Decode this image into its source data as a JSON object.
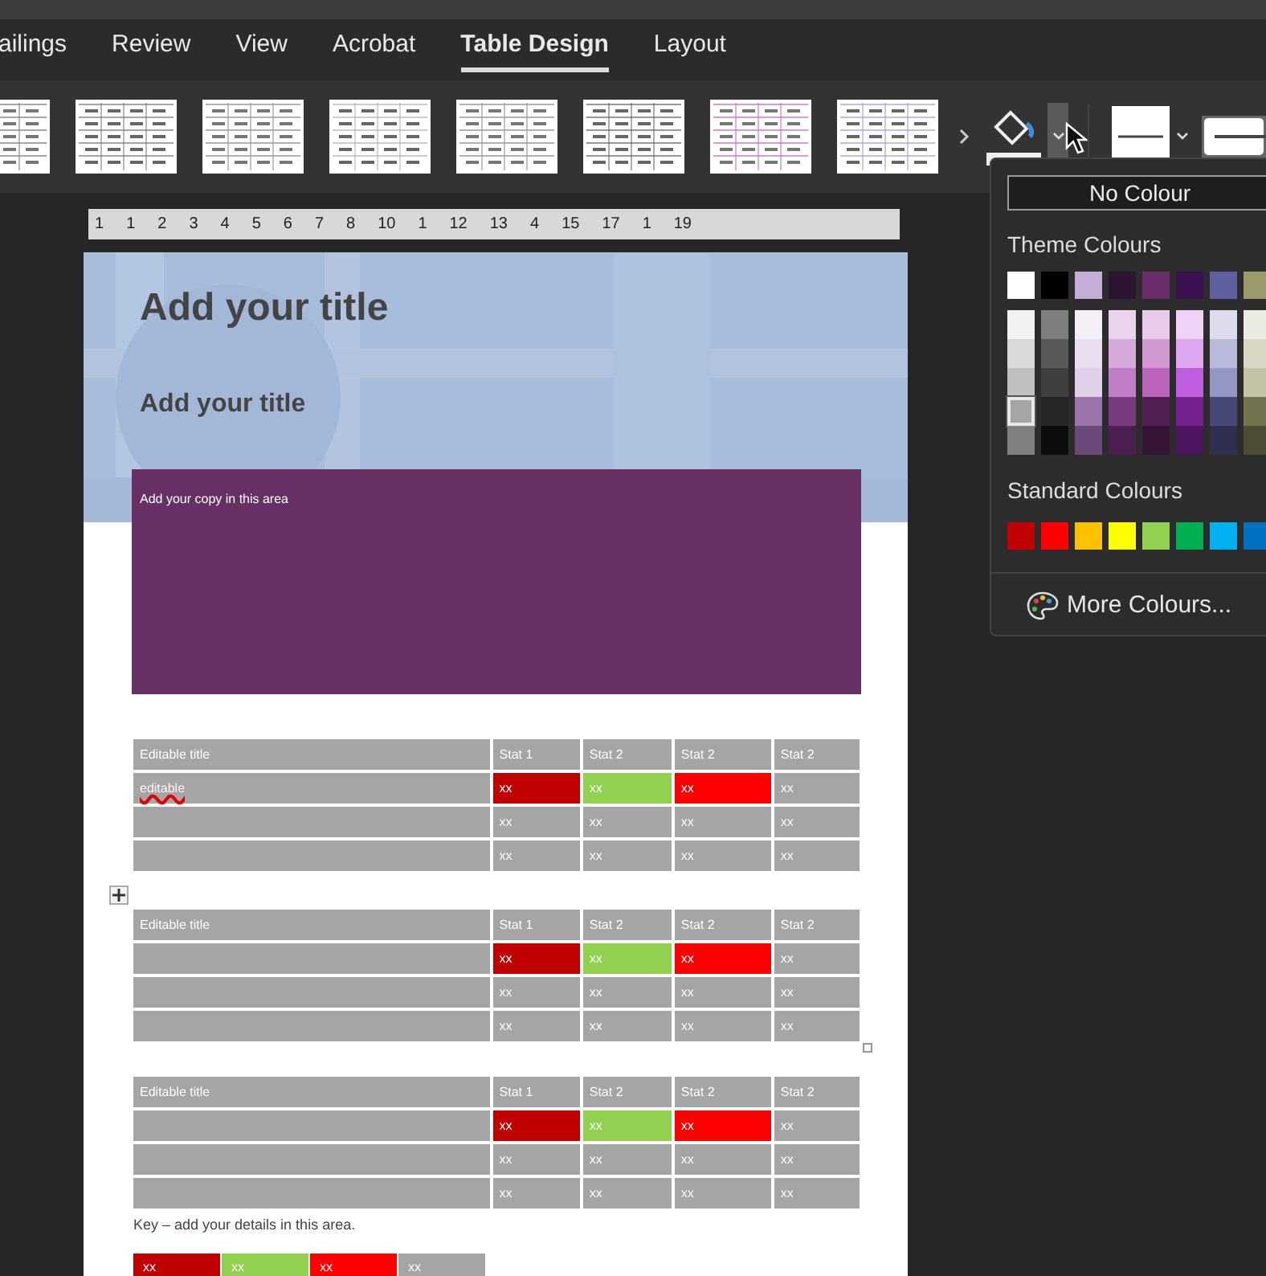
{
  "tabs": [
    {
      "label": "ailings",
      "selected": false
    },
    {
      "label": "Review",
      "selected": false
    },
    {
      "label": "View",
      "selected": false
    },
    {
      "label": "Acrobat",
      "selected": false
    },
    {
      "label": "Table Design",
      "selected": true
    },
    {
      "label": "Layout",
      "selected": false
    }
  ],
  "ruler": [
    "1",
    "1",
    "2",
    "3",
    "4",
    "5",
    "6",
    "7",
    "8",
    "10",
    "1",
    "12",
    "13",
    "4",
    "15",
    "17",
    "1",
    "19"
  ],
  "document": {
    "title": "Add your title",
    "subtitle": "Add your title",
    "copy": "Add your copy in this area",
    "tables": [
      {
        "header": [
          "Editable title",
          "Stat 1",
          "Stat 2",
          "Stat 2",
          "Stat 2"
        ],
        "rows": [
          {
            "label": "editable",
            "misspelled": true,
            "cells": [
              {
                "text": "xx",
                "color": "#c00000"
              },
              {
                "text": "xx",
                "color": "#92d050"
              },
              {
                "text": "xx",
                "color": "#ff0000"
              },
              {
                "text": "xx",
                "color": "#a5a5a5"
              }
            ]
          },
          {
            "cells": [
              {
                "text": "xx",
                "color": "#a5a5a5"
              },
              {
                "text": "xx",
                "color": "#a5a5a5"
              },
              {
                "text": "xx",
                "color": "#a5a5a5"
              },
              {
                "text": "xx",
                "color": "#a5a5a5"
              }
            ]
          },
          {
            "cells": [
              {
                "text": "xx",
                "color": "#a5a5a5"
              },
              {
                "text": "xx",
                "color": "#a5a5a5"
              },
              {
                "text": "xx",
                "color": "#a5a5a5"
              },
              {
                "text": "xx",
                "color": "#a5a5a5"
              }
            ]
          }
        ]
      },
      {
        "header": [
          "Editable title",
          "Stat 1",
          "Stat 2",
          "Stat 2",
          "Stat 2"
        ],
        "rows": [
          {
            "cells": [
              {
                "text": "xx",
                "color": "#c00000"
              },
              {
                "text": "xx",
                "color": "#92d050"
              },
              {
                "text": "xx",
                "color": "#ff0000"
              },
              {
                "text": "xx",
                "color": "#a5a5a5"
              }
            ]
          },
          {
            "cells": [
              {
                "text": "xx",
                "color": "#a5a5a5"
              },
              {
                "text": "xx",
                "color": "#a5a5a5"
              },
              {
                "text": "xx",
                "color": "#a5a5a5"
              },
              {
                "text": "xx",
                "color": "#a5a5a5"
              }
            ]
          },
          {
            "cells": [
              {
                "text": "xx",
                "color": "#a5a5a5"
              },
              {
                "text": "xx",
                "color": "#a5a5a5"
              },
              {
                "text": "xx",
                "color": "#a5a5a5"
              },
              {
                "text": "xx",
                "color": "#a5a5a5"
              }
            ]
          }
        ]
      },
      {
        "header": [
          "Editable title",
          "Stat 1",
          "Stat 2",
          "Stat 2",
          "Stat 2"
        ],
        "rows": [
          {
            "cells": [
              {
                "text": "xx",
                "color": "#c00000"
              },
              {
                "text": "xx",
                "color": "#92d050"
              },
              {
                "text": "xx",
                "color": "#ff0000"
              },
              {
                "text": "xx",
                "color": "#a5a5a5"
              }
            ]
          },
          {
            "cells": [
              {
                "text": "xx",
                "color": "#a5a5a5"
              },
              {
                "text": "xx",
                "color": "#a5a5a5"
              },
              {
                "text": "xx",
                "color": "#a5a5a5"
              },
              {
                "text": "xx",
                "color": "#a5a5a5"
              }
            ]
          },
          {
            "cells": [
              {
                "text": "xx",
                "color": "#a5a5a5"
              },
              {
                "text": "xx",
                "color": "#a5a5a5"
              },
              {
                "text": "xx",
                "color": "#a5a5a5"
              },
              {
                "text": "xx",
                "color": "#a5a5a5"
              }
            ]
          }
        ]
      }
    ],
    "key_text": "Key – add your details in this area.",
    "key": [
      {
        "text": "xx",
        "color": "#c00000"
      },
      {
        "text": "xx",
        "color": "#92d050"
      },
      {
        "text": "xx",
        "color": "#ff0000"
      },
      {
        "text": "xx",
        "color": "#a5a5a5"
      }
    ]
  },
  "colour_menu": {
    "no_colour": "No Colour",
    "theme_label": "Theme Colours",
    "theme": [
      {
        "color": "#ffffff",
        "selected": false
      },
      {
        "color": "#000000",
        "selected": false
      },
      {
        "color": "#c5aed6",
        "selected": false
      },
      {
        "color": "#2c1530",
        "selected": false
      },
      {
        "color": "#6b2c6b",
        "selected": false
      },
      {
        "color": "#3a1050",
        "selected": false
      },
      {
        "color": "#6060a0",
        "selected": false
      },
      {
        "color": "#9b9b6b",
        "selected": false
      }
    ],
    "tints": [
      [
        {
          "color": "#f2f2f2",
          "selected": false
        },
        {
          "color": "#d9d9d9",
          "selected": false
        },
        {
          "color": "#bfbfbf",
          "selected": false
        },
        {
          "color": "#a6a6a6",
          "selected": true
        },
        {
          "color": "#808080",
          "selected": false
        }
      ],
      [
        {
          "color": "#7f7f7f",
          "selected": false
        },
        {
          "color": "#595959",
          "selected": false
        },
        {
          "color": "#3f3f3f",
          "selected": false
        },
        {
          "color": "#262626",
          "selected": false
        },
        {
          "color": "#0d0d0d",
          "selected": false
        }
      ],
      [
        {
          "color": "#f4eff7",
          "selected": false
        },
        {
          "color": "#eadff0",
          "selected": false
        },
        {
          "color": "#dfcfe8",
          "selected": false
        },
        {
          "color": "#9c74ac",
          "selected": false
        },
        {
          "color": "#6a4a78",
          "selected": false
        }
      ],
      [
        {
          "color": "#ead4ec",
          "selected": false
        },
        {
          "color": "#d5a9da",
          "selected": false
        },
        {
          "color": "#c07ec7",
          "selected": false
        },
        {
          "color": "#7a3a80",
          "selected": false
        },
        {
          "color": "#4b1f50",
          "selected": false
        }
      ],
      [
        {
          "color": "#e8cbe8",
          "selected": false
        },
        {
          "color": "#d197d1",
          "selected": false
        },
        {
          "color": "#ba63ba",
          "selected": false
        },
        {
          "color": "#521f52",
          "selected": false
        },
        {
          "color": "#361436",
          "selected": false
        }
      ],
      [
        {
          "color": "#efd3f7",
          "selected": false
        },
        {
          "color": "#dea6ef",
          "selected": false
        },
        {
          "color": "#c05ee0",
          "selected": false
        },
        {
          "color": "#75208f",
          "selected": false
        },
        {
          "color": "#4c155d",
          "selected": false
        }
      ],
      [
        {
          "color": "#dcdcec",
          "selected": false
        },
        {
          "color": "#b9b9d9",
          "selected": false
        },
        {
          "color": "#9696c5",
          "selected": false
        },
        {
          "color": "#474778",
          "selected": false
        },
        {
          "color": "#2f2f4f",
          "selected": false
        }
      ],
      [
        {
          "color": "#ebebe1",
          "selected": false
        },
        {
          "color": "#d7d7c3",
          "selected": false
        },
        {
          "color": "#c3c3a5",
          "selected": false
        },
        {
          "color": "#737350",
          "selected": false
        },
        {
          "color": "#4d4d35",
          "selected": false
        }
      ]
    ],
    "standard_label": "Standard Colours",
    "standard": [
      {
        "color": "#c00000",
        "selected": false
      },
      {
        "color": "#ff0000",
        "selected": false
      },
      {
        "color": "#ffc000",
        "selected": false
      },
      {
        "color": "#ffff00",
        "selected": false
      },
      {
        "color": "#92d050",
        "selected": false
      },
      {
        "color": "#00b050",
        "selected": false
      },
      {
        "color": "#00b0f0",
        "selected": false
      },
      {
        "color": "#0070c0",
        "selected": false
      }
    ],
    "more": "More Colours..."
  }
}
